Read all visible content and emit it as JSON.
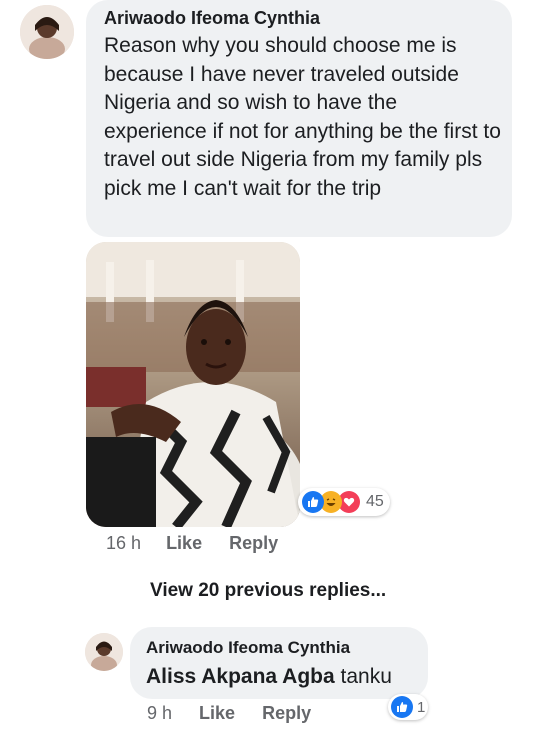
{
  "comment": {
    "author": "Ariwaodo Ifeoma Cynthia",
    "text": "Reason why you should choose me is because I have never traveled outside Nigeria and so wish to have the experience if not for anything be the first to travel out side Nigeria from my family pls pick me I can't wait for the trip",
    "reactions": {
      "icons": [
        "like-icon",
        "haha-icon",
        "love-icon"
      ],
      "count": "45"
    },
    "time": "16 h",
    "like_label": "Like",
    "reply_label": "Reply"
  },
  "view_previous": "View 20 previous replies...",
  "reply": {
    "author": "Ariwaodo Ifeoma Cynthia",
    "mention": "Aliss Akpana Agba",
    "text": "tanku",
    "reactions": {
      "icons": [
        "like-icon"
      ],
      "count": "1"
    },
    "time": "9 h",
    "like_label": "Like",
    "reply_label": "Reply"
  },
  "colors": {
    "bubble": "#eff1f3",
    "like": "#1877f2",
    "love": "#f33e58",
    "haha": "#f7b125",
    "meta": "#65676b"
  }
}
